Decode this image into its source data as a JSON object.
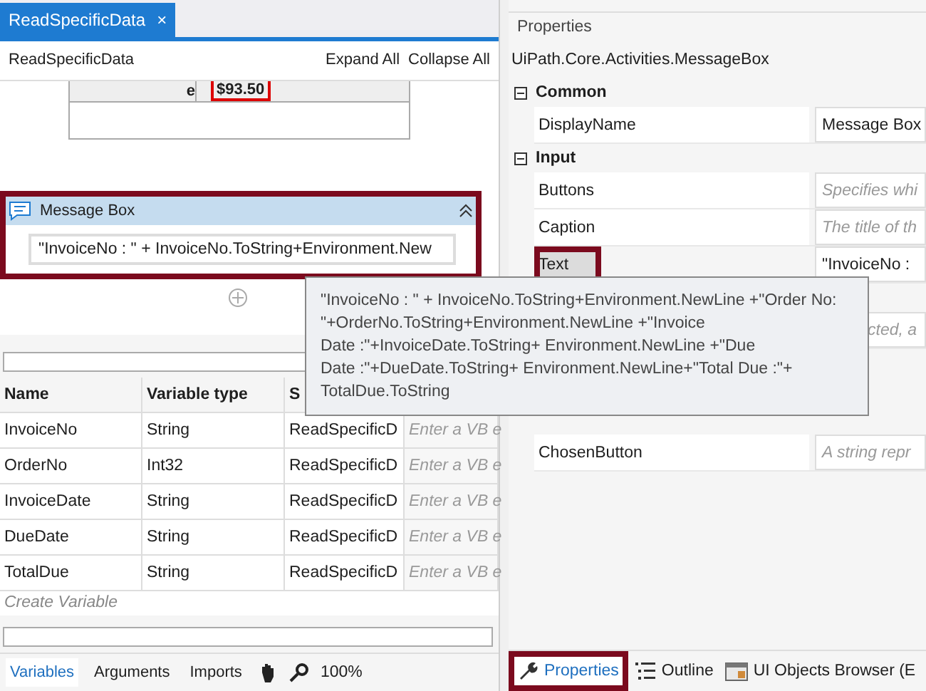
{
  "designer": {
    "tab": {
      "label": "ReadSpecificData",
      "close": "×"
    },
    "breadcrumb": "ReadSpecificData",
    "actions": [
      "Expand All",
      "Collapse All"
    ],
    "preview_cells": [
      "e",
      "$93.50"
    ],
    "activity": {
      "title": "Message Box",
      "expression": "\"InvoiceNo : \" + InvoiceNo.ToString+Environment.New",
      "highlighted": true
    }
  },
  "variables": {
    "columns": [
      "Name",
      "Variable type",
      "S"
    ],
    "rows": [
      {
        "name": "InvoiceNo",
        "type": "String",
        "scope": "ReadSpecificD",
        "placeholder": "Enter a VB e"
      },
      {
        "name": "OrderNo",
        "type": "Int32",
        "scope": "ReadSpecificD",
        "placeholder": "Enter a VB e"
      },
      {
        "name": "InvoiceDate",
        "type": "String",
        "scope": "ReadSpecificD",
        "placeholder": "Enter a VB e"
      },
      {
        "name": "DueDate",
        "type": "String",
        "scope": "ReadSpecificD",
        "placeholder": "Enter a VB e"
      },
      {
        "name": "TotalDue",
        "type": "String",
        "scope": "ReadSpecificD",
        "placeholder": "Enter a VB e"
      }
    ],
    "create": "Create Variable"
  },
  "bottom_tabs": [
    {
      "label": "Variables",
      "selected": true
    },
    {
      "label": "Arguments",
      "selected": false
    },
    {
      "label": "Imports",
      "selected": false
    }
  ],
  "zoom": "100%",
  "properties": {
    "title": "Properties",
    "type_name": "UiPath.Core.Activities.MessageBox",
    "groups": [
      {
        "name": "Common",
        "expanded": true,
        "rows": [
          {
            "name": "DisplayName",
            "value": "Message Box",
            "selected": false,
            "highlighted": false
          }
        ]
      },
      {
        "name": "Input",
        "expanded": true,
        "rows": [
          {
            "name": "Buttons",
            "placeholder": "Specifies whi",
            "selected": false,
            "highlighted": false
          },
          {
            "name": "Caption",
            "placeholder": "The title of th",
            "selected": false,
            "highlighted": false
          },
          {
            "name": "Text",
            "value": "\"InvoiceNo :",
            "selected": true,
            "highlighted": true
          }
        ]
      }
    ],
    "partial_placeholder": "cted, a",
    "output_row": {
      "name": "ChosenButton",
      "placeholder": "A string repr"
    },
    "tooltip": "\"InvoiceNo : \" + InvoiceNo.ToString+Environment.NewLine +\"Order No:\n\"+OrderNo.ToString+Environment.NewLine +\"Invoice\nDate :\"+InvoiceDate.ToString+ Environment.NewLine +\"Due\nDate :\"+DueDate.ToString+ Environment.NewLine+\"Total Due :\"+\nTotalDue.ToString"
  },
  "panel_tabs": [
    {
      "label": "Properties",
      "kind": "wrench",
      "selected": true,
      "highlighted": true
    },
    {
      "label": "Outline",
      "kind": "outline",
      "selected": false,
      "highlighted": false
    },
    {
      "label": "UI Objects Browser (E",
      "kind": "browser",
      "selected": false,
      "highlighted": false
    }
  ]
}
